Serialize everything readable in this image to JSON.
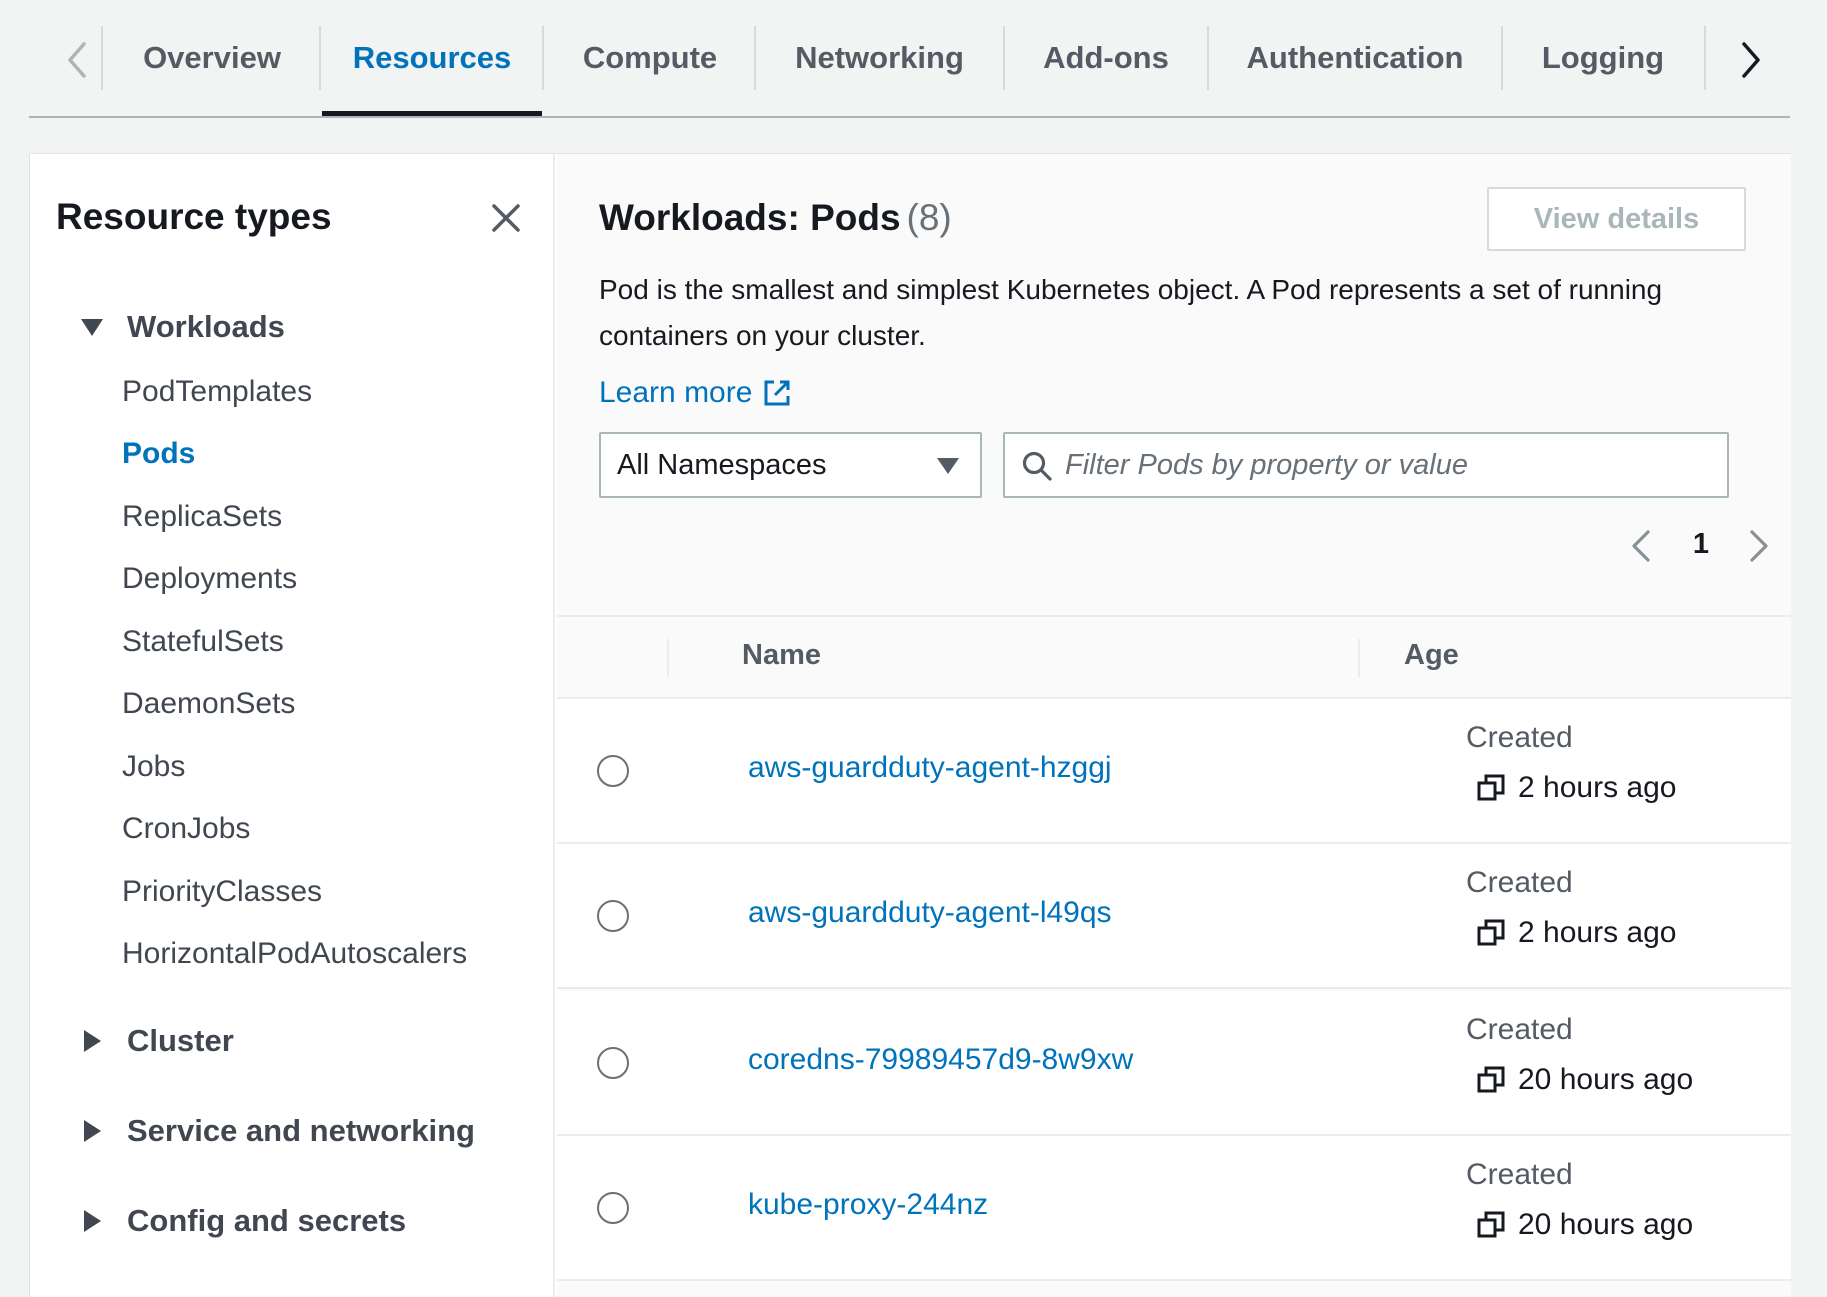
{
  "tabs": [
    {
      "label": "Overview",
      "active": false
    },
    {
      "label": "Resources",
      "active": true
    },
    {
      "label": "Compute",
      "active": false
    },
    {
      "label": "Networking",
      "active": false
    },
    {
      "label": "Add-ons",
      "active": false
    },
    {
      "label": "Authentication",
      "active": false
    },
    {
      "label": "Logging",
      "active": false
    }
  ],
  "sidebar": {
    "title": "Resource types",
    "groups": [
      {
        "label": "Workloads",
        "expanded": true,
        "items": [
          "PodTemplates",
          "Pods",
          "ReplicaSets",
          "Deployments",
          "StatefulSets",
          "DaemonSets",
          "Jobs",
          "CronJobs",
          "PriorityClasses",
          "HorizontalPodAutoscalers"
        ],
        "active_item": "Pods"
      },
      {
        "label": "Cluster",
        "expanded": false
      },
      {
        "label": "Service and networking",
        "expanded": false
      },
      {
        "label": "Config and secrets",
        "expanded": false
      }
    ]
  },
  "panel": {
    "title": "Workloads: Pods",
    "count": "(8)",
    "view_details_label": "View details",
    "description": "Pod is the smallest and simplest Kubernetes object. A Pod represents a set of running containers on your cluster.",
    "learn_more_label": "Learn more",
    "namespace_select": "All Namespaces",
    "filter_placeholder": "Filter Pods by property or value",
    "filter_value": "",
    "page": "1"
  },
  "table": {
    "columns": [
      "Name",
      "Age"
    ],
    "rows": [
      {
        "name": "aws-guardduty-agent-hzggj",
        "age_label": "Created",
        "age": "2 hours ago"
      },
      {
        "name": "aws-guardduty-agent-l49qs",
        "age_label": "Created",
        "age": "2 hours ago"
      },
      {
        "name": "coredns-79989457d9-8w9xw",
        "age_label": "Created",
        "age": "20 hours ago"
      },
      {
        "name": "kube-proxy-244nz",
        "age_label": "Created",
        "age": "20 hours ago"
      }
    ]
  },
  "colors": {
    "link": "#0073bb",
    "text": "#16191f",
    "muted": "#545b64",
    "background": "#f2f3f3"
  },
  "icons": {
    "tab_prev": "chevron-left-icon",
    "tab_next": "chevron-right-icon",
    "close": "close-icon",
    "expanded": "caret-down-icon",
    "collapsed": "caret-right-icon",
    "external": "external-link-icon",
    "dropdown": "dropdown-caret-icon",
    "search": "search-icon",
    "copy": "copy-icon"
  }
}
